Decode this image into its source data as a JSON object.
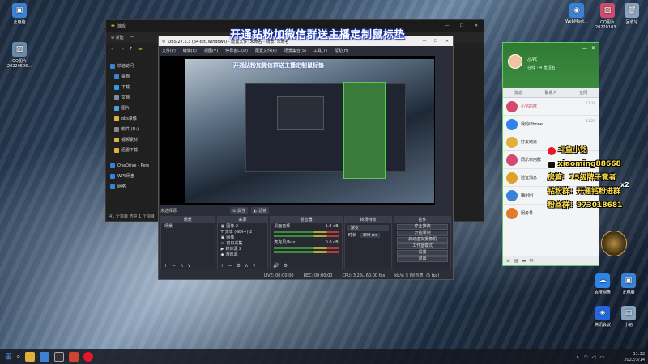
{
  "banner": "开通钻粉加微信群送主播定制鼠标垫",
  "desktop_icons": [
    {
      "label": "此电脑",
      "color": "#3b82d6"
    },
    {
      "label": "QQ图片20220506...",
      "color": "#6a8aa8"
    },
    {
      "label": "WebMeet...",
      "color": "#3b82d6"
    },
    {
      "label": "QQ图片20220103...",
      "color": "#d14b6f"
    },
    {
      "label": "回收站",
      "color": "#8aa4c0"
    },
    {
      "label": "百度网盘",
      "color": "#2f84e8"
    },
    {
      "label": "此电脑",
      "color": "#3b82d6"
    },
    {
      "label": "腾讯会议",
      "color": "#2466dd"
    },
    {
      "label": "小铭",
      "color": "#8aa4c0"
    }
  ],
  "explorer": {
    "title": "游戏",
    "new_label": "新建",
    "nav": [
      {
        "label": "快速访问",
        "color": "#3b82d6"
      },
      {
        "label": "桌面",
        "color": "#3b82d6"
      },
      {
        "label": "下载",
        "color": "#2f9ae8"
      },
      {
        "label": "文档",
        "color": "#7c8ea8"
      },
      {
        "label": "图片",
        "color": "#4aa3df"
      },
      {
        "label": "obs录像",
        "color": "#e0b03c"
      },
      {
        "label": "软件 (D:)",
        "color": "#888"
      },
      {
        "label": "视频素材",
        "color": "#e0b03c"
      },
      {
        "label": "迅雷下载",
        "color": "#e0b03c"
      },
      {
        "label": "OneDrive - Pers",
        "color": "#2f84e8"
      },
      {
        "label": "WPS网盘",
        "color": "#2f84e8"
      },
      {
        "label": "网络",
        "color": "#3b82d6"
      }
    ],
    "status": "41 个项目   选中 1 个项目"
  },
  "obs": {
    "title": "OBS 27.1.3 (64-bit, windows) - 配置文件: 未命名 - 场景: 未命名",
    "menu": [
      "文件(F)",
      "编辑(E)",
      "视图(V)",
      "停靠窗口(D)",
      "配置文件(P)",
      "场景集合(S)",
      "工具(T)",
      "帮助(H)"
    ],
    "no_source": "未选择源",
    "props_label": "属性",
    "filters_label": "滤镜",
    "docks": {
      "scenes": {
        "title": "场景",
        "items": [
          "场景"
        ]
      },
      "sources": {
        "title": "来源",
        "items": [
          "图像 2",
          "文本 (GDI+) 2",
          "图像",
          "窗口采集",
          "媒体源 2",
          "游戏源"
        ]
      },
      "mixer": {
        "title": "混音器",
        "tracks": [
          {
            "name": "桌面音频",
            "db": "-1.8 dB"
          },
          {
            "name": "麦克风/Aux",
            "db": "0.0 dB"
          }
        ]
      },
      "transitions": {
        "title": "转场特效",
        "type": "渐变",
        "duration_label": "时长",
        "duration": "300 ms"
      },
      "controls": {
        "title": "控件",
        "buttons": [
          "停止推流",
          "开始录制",
          "启动虚拟摄像机",
          "工作室模式",
          "设置",
          "退出"
        ]
      }
    },
    "status": [
      "LIVE: 00:00:00",
      "REC: 00:00:00",
      "CPU: 3.2%, 60.00 fps",
      "kb/s: 5 (显示表) (5 fps)"
    ]
  },
  "qq": {
    "name": "小铭",
    "status": "在线 - 4 宽恒名",
    "tabs": [
      "消息",
      "联系人",
      "空间"
    ],
    "rows": [
      {
        "title": "小铭的群",
        "sub": "",
        "time": "11:38",
        "color": "#d14b6f"
      },
      {
        "title": "我的iPhone",
        "sub": "",
        "time": "11:20",
        "color": "#2f84e8"
      },
      {
        "title": "好友动态",
        "sub": "",
        "time": "",
        "color": "#e0b03c"
      },
      {
        "title": "同乐家用群",
        "sub": "",
        "time": "",
        "color": "#d14b6f"
      },
      {
        "title": "验证消息",
        "sub": "",
        "time": "",
        "color": "#e0a02c"
      },
      {
        "title": "梅州团",
        "sub": "",
        "time": "",
        "color": "#3b82d6"
      },
      {
        "title": "服务号",
        "sub": "",
        "time": "",
        "color": "#e07b2c"
      }
    ]
  },
  "overlay": {
    "weibo": "斗鱼小铭",
    "tiktok": "xiaoming88668",
    "lines": [
      "房管：15级牌子竟者",
      "钻粉群：开通钻粉进群",
      "粉丝群：973018681"
    ],
    "x2": "x2"
  },
  "taskbar": {
    "time": "11:13",
    "date": "2022/3/14"
  }
}
